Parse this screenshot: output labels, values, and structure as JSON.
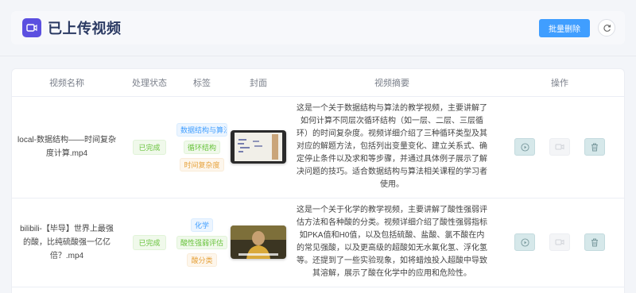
{
  "header": {
    "title": "已上传视频",
    "batch_delete_label": "批量删除"
  },
  "table": {
    "columns": [
      "视频名称",
      "处理状态",
      "标签",
      "封面",
      "视频摘要",
      "操作"
    ],
    "rows": [
      {
        "name": "local-数据结构——时间复杂度计算.mp4",
        "status": "已完成",
        "tags": [
          "数据结构与算法",
          "循环结构",
          "时间复杂度"
        ],
        "summary": "这是一个关于数据结构与算法的教学视频，主要讲解了如何计算不同层次循环结构（如一层、二层、三层循环）的时间复杂度。视频详细介绍了三种循环类型及其对应的解题方法，包括列出变量变化、建立关系式、确定停止条件以及求和等步骤，并通过具体例子展示了解决问题的技巧。适合数据结构与算法相关课程的学习者使用。"
      },
      {
        "name": "bilibili-【毕导】世界上最强的酸，比纯硫酸强一亿亿倍？.mp4",
        "status": "已完成",
        "tags": [
          "化学",
          "酸性强弱评估",
          "酸分类"
        ],
        "summary": "这是一个关于化学的教学视频，主要讲解了酸性强弱评估方法和各种酸的分类。视频详细介绍了酸性强弱指标如PKA值和H0值，以及包括硫酸、盐酸、氯不酸在内的常见强酸，以及更高级的超酸如无水氟化氢、浮化氢等。还提到了一些实验现象，如将蜡烛投入超酸中导致其溶解，展示了酸在化学中的应用和危险性。"
      }
    ]
  },
  "colors": {
    "primary": "#409eff",
    "brand": "#5b4fe0",
    "success": "#67c23a"
  }
}
